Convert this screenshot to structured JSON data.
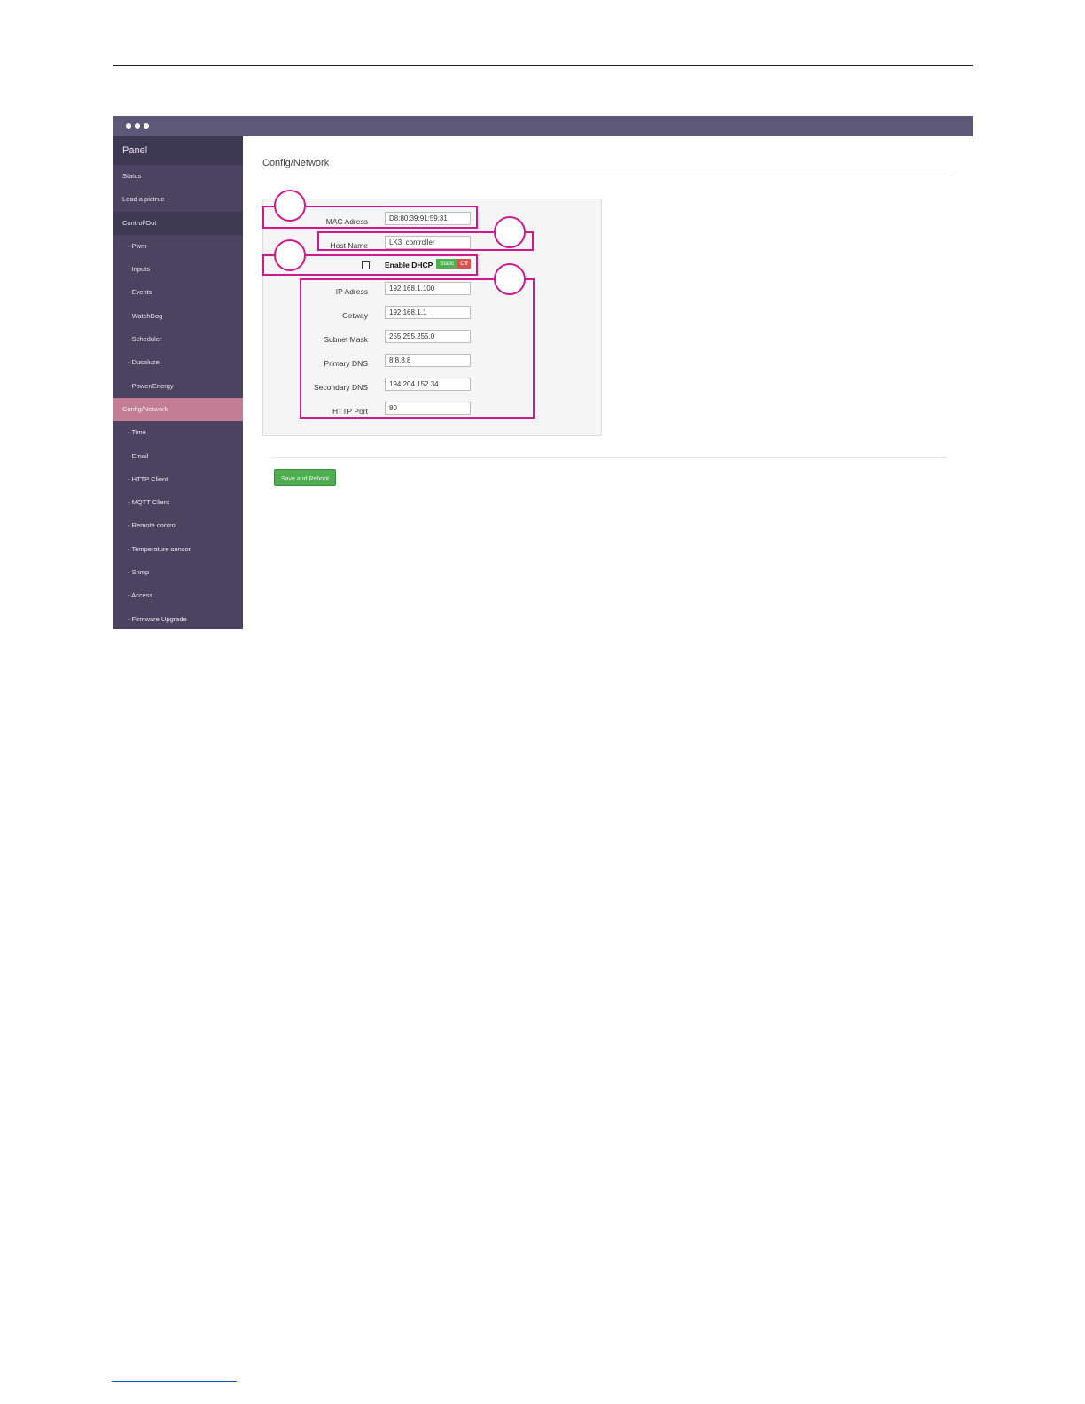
{
  "sidebar": {
    "heading": "Panel",
    "items": [
      {
        "label": "Status"
      },
      {
        "label": "Load a pictrue"
      },
      {
        "label": "Control/Out"
      },
      {
        "label": "- Pwm"
      },
      {
        "label": "- Inputs"
      },
      {
        "label": "- Events"
      },
      {
        "label": "- WatchDog"
      },
      {
        "label": "- Scheduler"
      },
      {
        "label": "- Dusaluze"
      },
      {
        "label": "- Power/Energy"
      },
      {
        "label": "Config/Network"
      },
      {
        "label": "- Time"
      },
      {
        "label": "- Email"
      },
      {
        "label": "- HTTP Client"
      },
      {
        "label": "- MQTT Client"
      },
      {
        "label": "- Remote control"
      },
      {
        "label": "- Temperature sensor"
      },
      {
        "label": "- Snmp"
      },
      {
        "label": "- Access"
      },
      {
        "label": "- Firmware Upgrade"
      }
    ]
  },
  "main": {
    "title": "Config/Network",
    "fields": {
      "mac": {
        "label": "MAC Adress",
        "value": "D8:80:39:91:59:31"
      },
      "host": {
        "label": "Host Name",
        "value": "LK3_controller"
      },
      "dhcp": {
        "label": "Enable DHCP",
        "checked": false,
        "toggle_on": "Static",
        "toggle_off": "Off"
      },
      "ip": {
        "label": "IP Adress",
        "value": "192.168.1.100"
      },
      "gateway": {
        "label": "Getway",
        "value": "192.168.1.1"
      },
      "subnet": {
        "label": "Subnet Mask",
        "value": "255.255.255.0"
      },
      "dns1": {
        "label": "Primary DNS",
        "value": "8.8.8.8"
      },
      "dns2": {
        "label": "Secondary DNS",
        "value": "194.204.152.34"
      },
      "port": {
        "label": "HTTP Port",
        "value": "80"
      }
    },
    "save_label": "Save and Reboot"
  },
  "colors": {
    "titlebar": "#5e5878",
    "sidebar": "#4a4460",
    "sidebar_active": "#c27c93",
    "highlight": "#d3188f",
    "save_button": "#4cae4f",
    "toggle_on": "#4cb050",
    "toggle_off": "#d9534f"
  }
}
